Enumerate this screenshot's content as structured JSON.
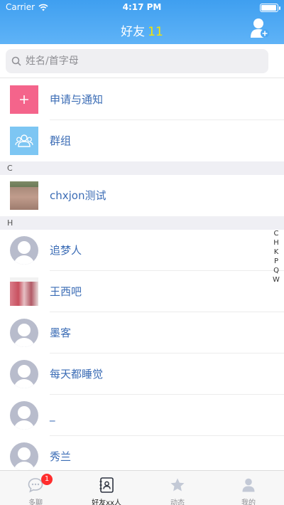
{
  "status_bar": {
    "carrier": "Carrier",
    "time": "4:17 PM"
  },
  "nav": {
    "title": "好友",
    "count": "11"
  },
  "search": {
    "placeholder": "姓名/首字母"
  },
  "specials": [
    {
      "label": "申请与通知",
      "icon": "plus-icon",
      "color": "#f4648b"
    },
    {
      "label": "群组",
      "icon": "group-icon",
      "color": "#7dc6f3"
    }
  ],
  "sections": [
    {
      "letter": "C",
      "contacts": [
        {
          "name": "chxjon测试",
          "avatar": "photo"
        }
      ]
    },
    {
      "letter": "H",
      "contacts": [
        {
          "name": "追梦人",
          "avatar": "default"
        },
        {
          "name": "王西吧",
          "avatar": "photo"
        },
        {
          "name": "墨客",
          "avatar": "default"
        },
        {
          "name": "每天都睡觉",
          "avatar": "default"
        },
        {
          "name": "_",
          "avatar": "default"
        },
        {
          "name": "秀兰",
          "avatar": "default"
        }
      ]
    }
  ],
  "index": [
    "C",
    "H",
    "K",
    "P",
    "Q",
    "W"
  ],
  "tabs": [
    {
      "label": "多聊",
      "icon": "chat-icon",
      "badge": "1"
    },
    {
      "label": "好友xx人",
      "icon": "contacts-icon",
      "active": true
    },
    {
      "label": "动态",
      "icon": "star-icon"
    },
    {
      "label": "我的",
      "icon": "person-icon"
    }
  ],
  "colors": {
    "header": "#4aa6f3",
    "accent_count": "#f6e400",
    "name_text": "#3b6cb5"
  }
}
